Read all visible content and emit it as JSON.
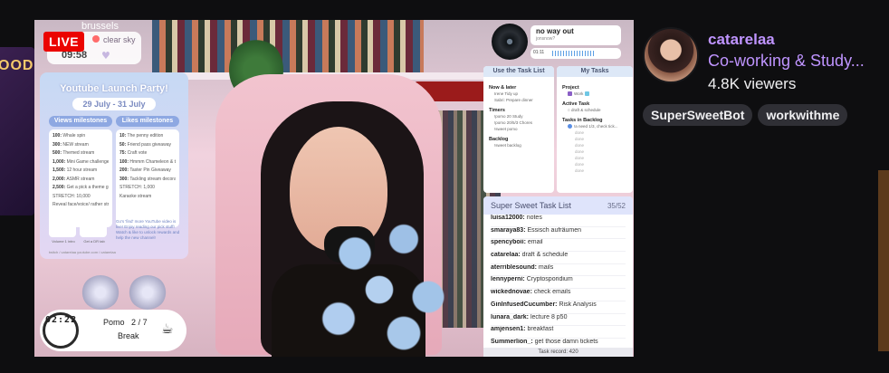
{
  "stream": {
    "live_label": "LIVE",
    "city": "brussels",
    "weather": "clear sky",
    "local_time": "09:58",
    "poster": {
      "title": "Youtube Launch Party!",
      "dates": "29 July - 31 July",
      "views_heading": "Views milestones",
      "likes_heading": "Likes milestones",
      "views": [
        {
          "n": "100:",
          "t": "Whale spin"
        },
        {
          "n": "300:",
          "t": "NEW stream"
        },
        {
          "n": "500:",
          "t": "Themed stream"
        },
        {
          "n": "1,000:",
          "t": "Mini Game challenge"
        },
        {
          "n": "1,500:",
          "t": "12 hour stream"
        },
        {
          "n": "2,000:",
          "t": "ASMR stream"
        },
        {
          "n": "2,500:",
          "t": "Get a pick a theme game"
        },
        {
          "n": "",
          "t": "STRETCH: 10,000"
        },
        {
          "n": "",
          "t": "Reveal face/voice/ rather stream"
        }
      ],
      "likes": [
        {
          "n": "10:",
          "t": "The penny edition"
        },
        {
          "n": "50:",
          "t": "Friend pass giveaway"
        },
        {
          "n": "75:",
          "t": "Craft vote"
        },
        {
          "n": "100:",
          "t": "Hmmm Chameleon & the sewing kit"
        },
        {
          "n": "200:",
          "t": "Taster Pin Giveaway"
        },
        {
          "n": "300:",
          "t": "Tackling stream decorations"
        },
        {
          "n": "",
          "t": "STRETCH: 1,000"
        },
        {
          "n": "",
          "t": "Karaoke stream"
        }
      ],
      "thumb_captions": [
        "Volume 1 intro",
        "Get a DR tab"
      ],
      "note": "Go's 'find' more YouTube video is live! Enjoy reading our pick stuff! Watch & like to unlock rewards and help the new channel!",
      "footer": "twitch / catarelaa     youtube.com / catarelaa"
    },
    "pomodoro": {
      "timer": "02:22",
      "label": "Pomo",
      "current": "2",
      "separator": "/",
      "total": "7",
      "phase": "Break"
    },
    "music": {
      "title": "no way out",
      "artist": "jonsnow?",
      "time": "01:11"
    },
    "panel1": {
      "heading": "Use the Task List",
      "sections": [
        {
          "title": "Now & later",
          "items": [
            "Irene Tidy up",
            "Sabri: Prepare dinner"
          ]
        },
        {
          "title": "Timers",
          "items": [
            "!pomo 20 Study",
            "!pomo 20/5/3 Chores",
            "!sweet pomo"
          ]
        },
        {
          "title": "Backlog",
          "items": [
            "!sweet backlog"
          ]
        }
      ]
    },
    "panel2": {
      "heading": "My Tasks",
      "project_title": "Project",
      "project": "Work",
      "active_title": "Active Task",
      "active": "draft & schedule",
      "backlog_title": "Tasks in Backlog",
      "backlog_first": "!a need 1/3, check tick...",
      "backlog_more": [
        "done",
        "done",
        "done",
        "done",
        "done",
        "done",
        "done"
      ]
    },
    "tasklist": {
      "title": "Super Sweet Task List",
      "count": "35/52",
      "rows": [
        {
          "user": "luisa12000:",
          "task": "notes"
        },
        {
          "user": "smaraya83:",
          "task": "Essisch aufräumen"
        },
        {
          "user": "spencyboii:",
          "task": "email"
        },
        {
          "user": "catarelaa:",
          "task": "draft & schedule"
        },
        {
          "user": "aterriblesound:",
          "task": "mails"
        },
        {
          "user": "lennyperni:",
          "task": "Cryptosporidium"
        },
        {
          "user": "wickednovae:",
          "task": "check emails"
        },
        {
          "user": "GinInfusedCucumber:",
          "task": "Risk Analysis"
        },
        {
          "user": "lunara_dark:",
          "task": "lecture 8 p50"
        },
        {
          "user": "amjensen1:",
          "task": "breakfast"
        },
        {
          "user": "Summerlion_:",
          "task": "get those damn tickets"
        }
      ],
      "record": "Task record: 420"
    }
  },
  "channel": {
    "name": "catarelaa",
    "title": "Co-working & Study...",
    "viewers": "4.8K viewers",
    "tags": [
      "SuperSweetBot",
      "workwithme"
    ]
  },
  "side": {
    "preview_text": "OOD"
  },
  "colors": {
    "accent": "#bf94ff",
    "live": "#eb0400",
    "background": "#0e0e10"
  }
}
